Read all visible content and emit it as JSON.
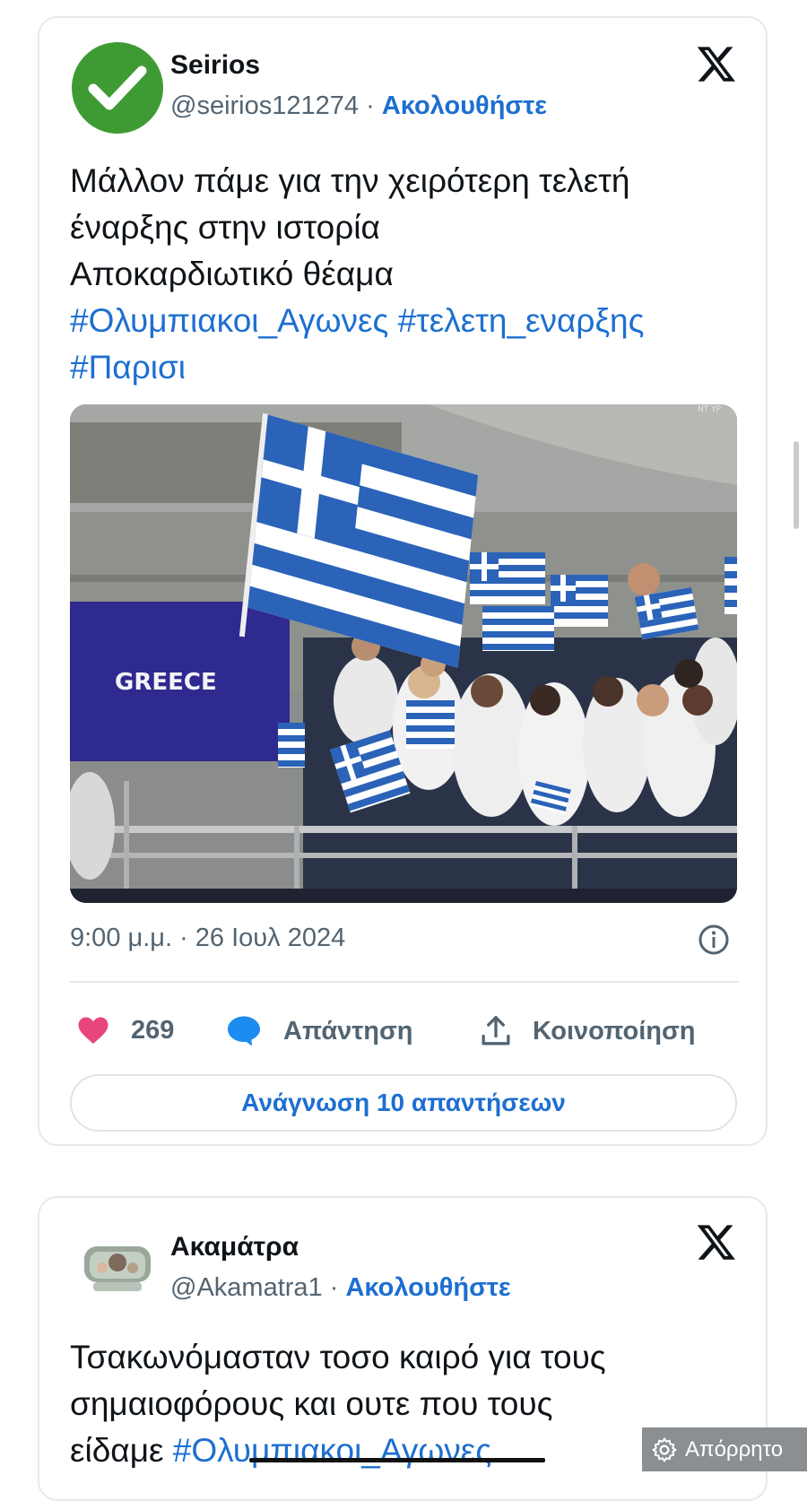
{
  "tweets": [
    {
      "author": "Seirios",
      "handle": "@seirios121274",
      "separator": "·",
      "follow_label": "Ακολουθήστε",
      "text_lines": [
        "Μάλλον πάμε για την χειρότερη τελετή",
        "έναρξης στην ιστορία",
        "Αποκαρδιωτικό θέαμα"
      ],
      "hashtags": [
        "#Ολυμπιακοι_Αγωνες",
        "#τελετη_εναρξης",
        "#Παρισι"
      ],
      "media": {
        "sign_text": "GREECE",
        "corner_text": "ΝΤ ΥΡ"
      },
      "meta": "9:00 μ.μ. · 26 Ιουλ 2024",
      "likes": "269",
      "reply_label": "Απάντηση",
      "share_label": "Κοινοποίηση",
      "read_replies_label": "Ανάγνωση 10 απαντήσεων"
    },
    {
      "author": "Ακαμάτρα",
      "handle": "@Akamatra1",
      "separator": "·",
      "follow_label": "Ακολουθήστε",
      "text_lines": [
        "Τσακωνόμασταν τοσο καιρό για τους",
        "σημαιοφόρους και ουτε που τους",
        "είδαμε"
      ],
      "hashtag": "#Ολυμπιακοι_Αγωνες"
    }
  ],
  "privacy_badge": "Απόρρητο",
  "colors": {
    "accent": "#1d6fd1",
    "like": "#e8457e",
    "verified_green": "#3e9b33"
  },
  "icons": [
    "verified-check-icon",
    "x-logo-icon",
    "info-icon",
    "heart-icon",
    "reply-bubble-icon",
    "share-icon",
    "gear-icon"
  ]
}
